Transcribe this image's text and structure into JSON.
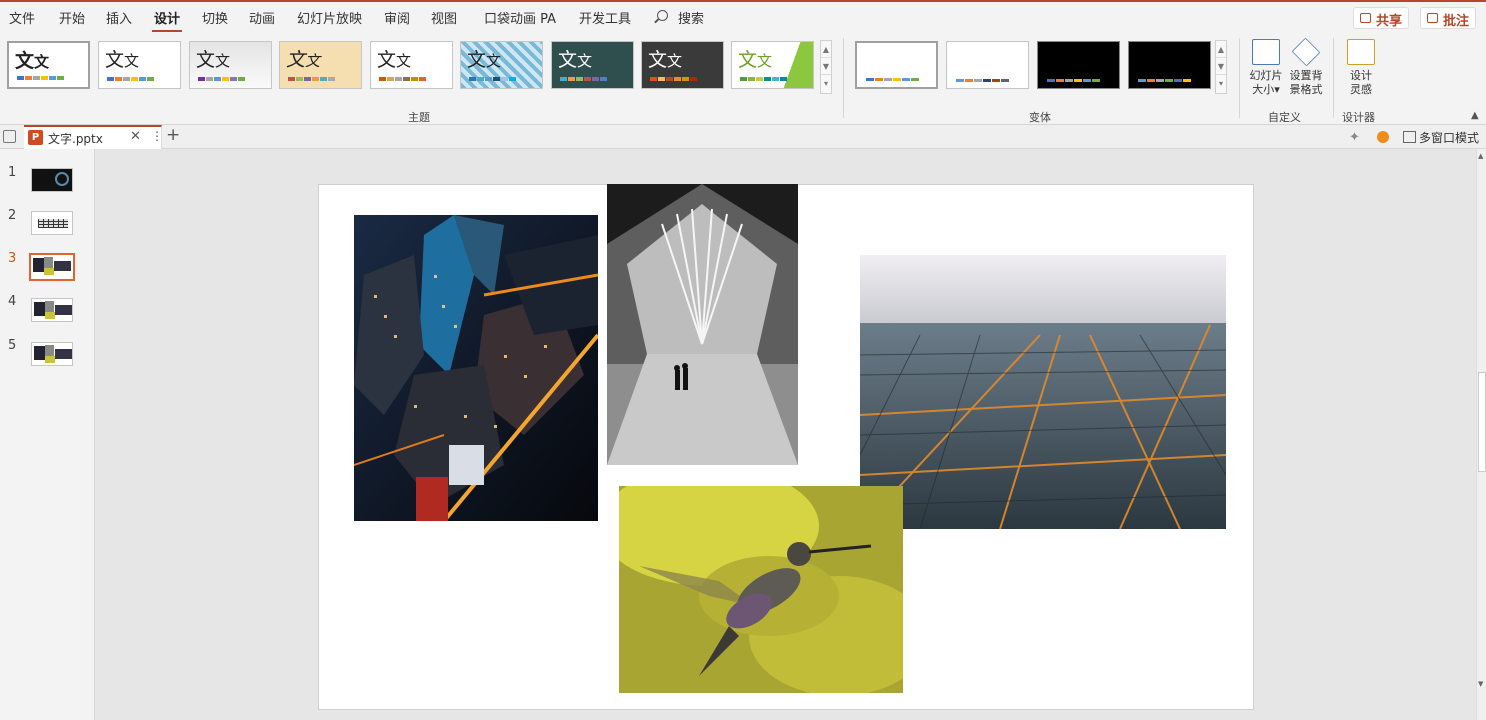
{
  "menu": {
    "items": [
      "文件",
      "开始",
      "插入",
      "设计",
      "切换",
      "动画",
      "幻灯片放映",
      "审阅",
      "视图",
      "口袋动画 PA",
      "开发工具"
    ],
    "active_index": 3,
    "search_label": "搜索",
    "share_label": "共享",
    "comment_label": "批注"
  },
  "ribbon": {
    "themes_group_label": "主题",
    "variants_group_label": "变体",
    "customize_group_label": "自定义",
    "designer_group_label": "设计器",
    "theme_sample_text": "文",
    "slide_size_label_1": "幻灯片",
    "slide_size_label_2": "大小",
    "format_bg_label_1": "设置背",
    "format_bg_label_2": "景格式",
    "design_ideas_label_1": "设计",
    "design_ideas_label_2": "灵感"
  },
  "tabs": {
    "file_name": "文字.pptx",
    "multiwindow_label": "多窗口模式"
  },
  "slides": {
    "numbers": [
      "1",
      "2",
      "3",
      "4",
      "5"
    ],
    "current": 3
  },
  "colors": {
    "accent": "#b7472a",
    "selection": "#e2632e"
  }
}
